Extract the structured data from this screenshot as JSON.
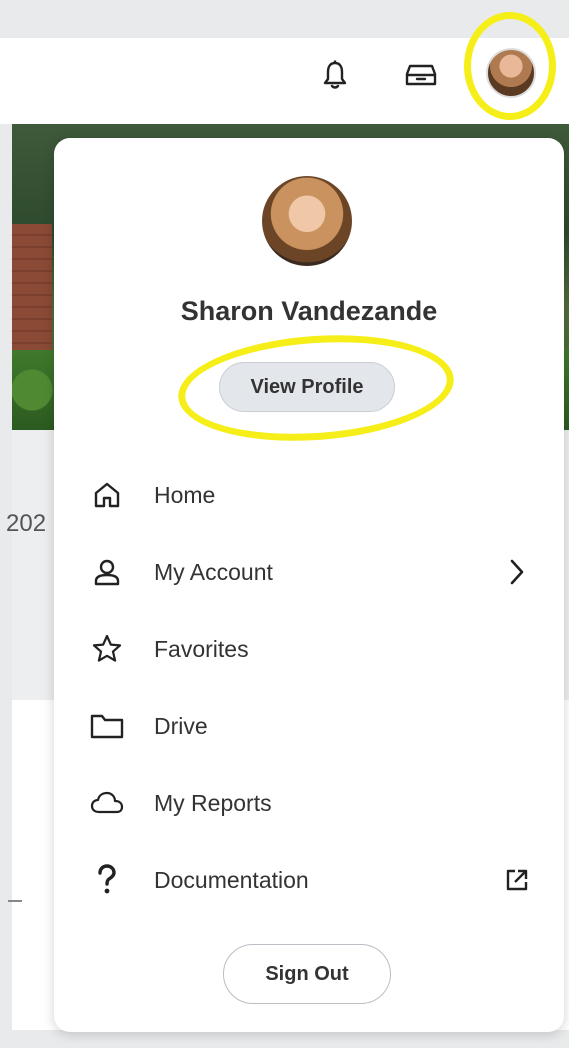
{
  "background": {
    "year_fragment": "202"
  },
  "header": {
    "notifications_icon": "bell-icon",
    "inbox_icon": "inbox-icon",
    "avatar_icon": "user-avatar"
  },
  "profile_menu": {
    "user_name": "Sharon Vandezande",
    "view_profile_label": "View Profile",
    "items": [
      {
        "label": "Home",
        "icon": "home-icon",
        "trailing": ""
      },
      {
        "label": "My Account",
        "icon": "person-icon",
        "trailing": "chevron-right-icon"
      },
      {
        "label": "Favorites",
        "icon": "star-icon",
        "trailing": ""
      },
      {
        "label": "Drive",
        "icon": "folder-icon",
        "trailing": ""
      },
      {
        "label": "My Reports",
        "icon": "cloud-icon",
        "trailing": ""
      },
      {
        "label": "Documentation",
        "icon": "question-icon",
        "trailing": "external-link-icon"
      }
    ],
    "sign_out_label": "Sign Out"
  },
  "colors": {
    "highlight": "#f6ee18",
    "text": "#333333",
    "button_bg": "#e3e7ec"
  }
}
